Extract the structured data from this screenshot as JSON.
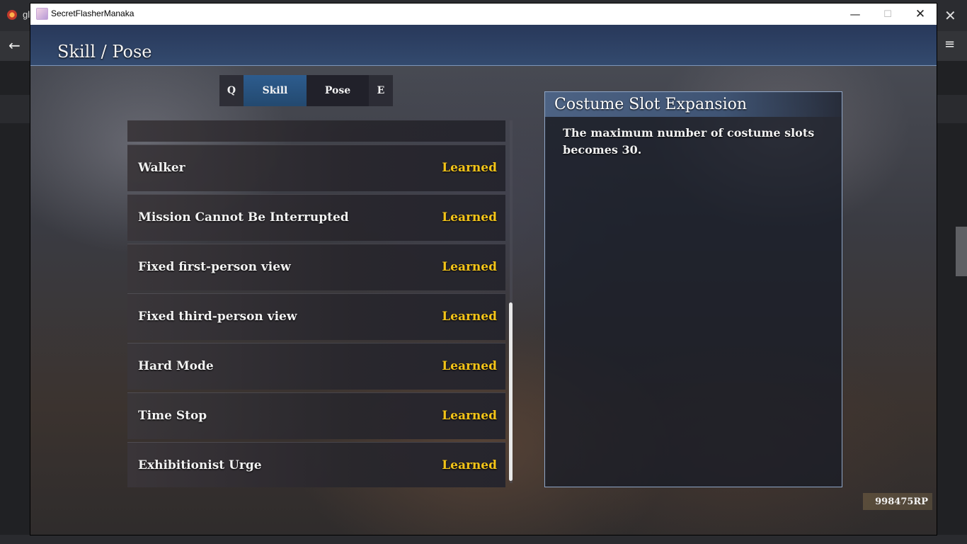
{
  "browser": {
    "tab_title": "gl",
    "close_glyph": "✕",
    "back_glyph": "←",
    "menu_glyph": "≡"
  },
  "window": {
    "title": "SecretFlasherManaka",
    "controls": {
      "minimize": "—",
      "maximize": "☐",
      "close": "✕"
    }
  },
  "header": {
    "title": "Skill / Pose"
  },
  "tabs": {
    "prev_key": "Q",
    "next_key": "E",
    "items": [
      {
        "label": "Skill",
        "active": true
      },
      {
        "label": "Pose",
        "active": false
      }
    ]
  },
  "skills": [
    {
      "name": "Walker",
      "status": "Learned"
    },
    {
      "name": "Mission Cannot Be Interrupted",
      "status": "Learned"
    },
    {
      "name": "Fixed first-person view",
      "status": "Learned"
    },
    {
      "name": "Fixed third-person view",
      "status": "Learned"
    },
    {
      "name": "Hard Mode",
      "status": "Learned"
    },
    {
      "name": "Time Stop",
      "status": "Learned"
    },
    {
      "name": "Exhibitionist Urge",
      "status": "Learned"
    }
  ],
  "detail": {
    "title": "Costume Slot Expansion",
    "description": "The maximum number of costume slots becomes 30."
  },
  "points": {
    "value": "998475RP"
  },
  "colors": {
    "learned": "#f5c518",
    "header_bg": "#2e4264",
    "active_tab": "#2d5c8e",
    "panel_border": "#8fa6c7"
  }
}
